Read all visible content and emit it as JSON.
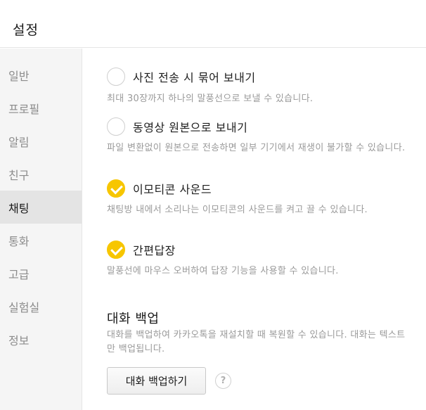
{
  "window": {
    "title": "설정"
  },
  "sidebar": {
    "items": [
      {
        "label": "일반",
        "active": false
      },
      {
        "label": "프로필",
        "active": false
      },
      {
        "label": "알림",
        "active": false
      },
      {
        "label": "친구",
        "active": false
      },
      {
        "label": "채팅",
        "active": true
      },
      {
        "label": "통화",
        "active": false
      },
      {
        "label": "고급",
        "active": false
      },
      {
        "label": "실험실",
        "active": false
      },
      {
        "label": "정보",
        "active": false
      }
    ]
  },
  "chat_settings": {
    "options": [
      {
        "label": "사진 전송 시 묶어 보내기",
        "checked": false,
        "desc": "최대 30장까지 하나의 말풍선으로 보낼 수 있습니다."
      },
      {
        "label": "동영상 원본으로 보내기",
        "checked": false,
        "desc": "파일 변환없이 원본으로 전송하면 일부 기기에서 재생이 불가할 수 있습니다."
      },
      {
        "label": "이모티콘 사운드",
        "checked": true,
        "desc": "채팅방 내에서 소리나는 이모티콘의 사운드를 켜고 끌 수 있습니다."
      },
      {
        "label": "간편답장",
        "checked": true,
        "desc": "말풍선에 마우스 오버하여 답장 기능을 사용할 수 있습니다."
      }
    ],
    "backup": {
      "title": "대화 백업",
      "desc": "대화를 백업하여 카카오톡을 재설치할 때 복원할 수 있습니다. 대화는 텍스트만 백업됩니다.",
      "button_label": "대화 백업하기",
      "help_glyph": "?"
    }
  },
  "colors": {
    "accent": "#f7c600",
    "sidebar_bg": "#f5f5f5",
    "sidebar_active_bg": "#e4e4e4"
  },
  "icons": {
    "check": "check-icon",
    "help": "help-icon"
  }
}
